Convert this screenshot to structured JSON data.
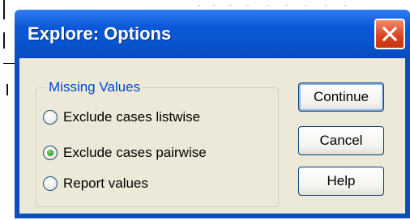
{
  "window": {
    "title": "Explore: Options"
  },
  "missing_values": {
    "group_label": "Missing Values",
    "options": [
      {
        "label": "Exclude cases listwise",
        "selected": false
      },
      {
        "label": "Exclude cases pairwise",
        "selected": true
      },
      {
        "label": "Report values",
        "selected": false
      }
    ]
  },
  "buttons": {
    "continue_label": "Continue",
    "cancel_label": "Cancel",
    "help_label": "Help"
  },
  "colors": {
    "title_bar": "#0a4fc0",
    "close_button": "#d9411e",
    "dialog_face": "#ece9d8",
    "group_label": "#0046d5",
    "radio_selected": "#21a121"
  },
  "icons": {
    "close": "close-icon",
    "radio_selected": "radio-selected-icon",
    "radio_unselected": "radio-unselected-icon"
  }
}
